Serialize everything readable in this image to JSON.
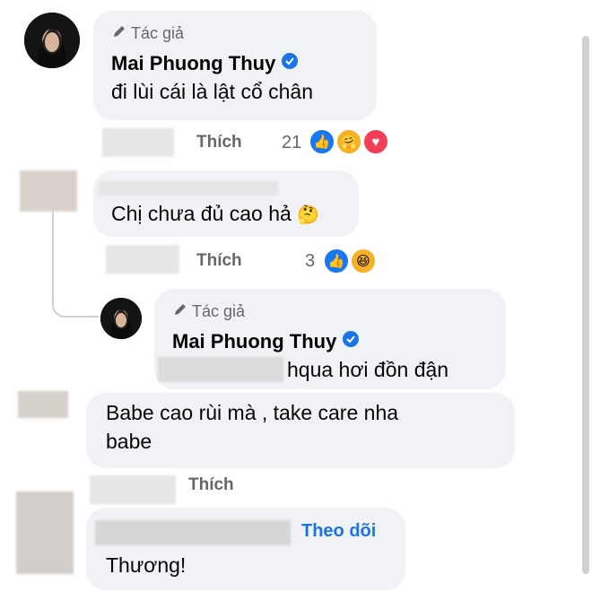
{
  "comments": [
    {
      "author_tag": "Tác giả",
      "name": "Mai Phuong Thuy",
      "text": "đi lùi cái là lật cổ chân",
      "like_label": "Thích",
      "reaction_count": "21"
    },
    {
      "text": "Chị chưa đủ cao hả",
      "like_label": "Thích",
      "reaction_count": "3"
    },
    {
      "author_tag": "Tác giả",
      "name": "Mai Phuong Thuy",
      "text_suffix": "hqua hơi đồn đận"
    },
    {
      "text_line1": "Babe cao rùi mà , take care nha",
      "text_line2": "babe",
      "like_label": "Thích"
    },
    {
      "follow_label": "Theo dõi",
      "text": "Thương!"
    }
  ],
  "icons": {
    "pencil": "pencil-icon",
    "verified": "verified-badge-icon",
    "like": "like-reaction-icon",
    "care": "care-reaction-icon",
    "love": "love-reaction-icon",
    "haha": "haha-reaction-icon",
    "emoji": "thinking-emoji-icon"
  },
  "colors": {
    "bubble": "#f0f2f5",
    "verified": "#1b74e4",
    "like_blue": "#1877f2",
    "love_red": "#f33e58"
  }
}
